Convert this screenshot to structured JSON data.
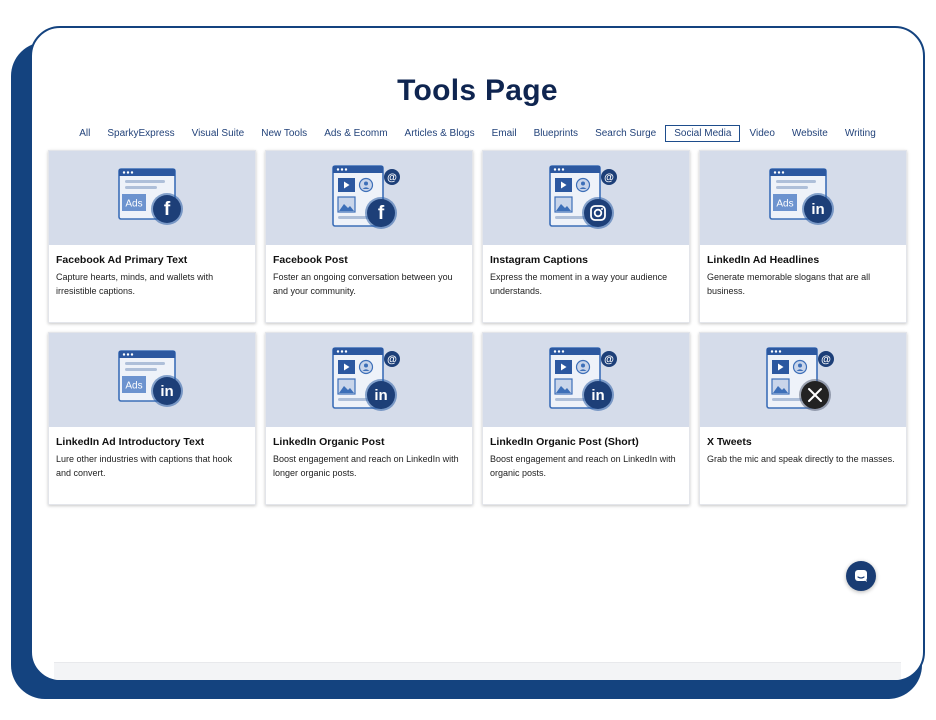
{
  "page": {
    "title": "Tools Page"
  },
  "tabs": [
    {
      "label": "All"
    },
    {
      "label": "SparkyExpress"
    },
    {
      "label": "Visual Suite"
    },
    {
      "label": "New Tools"
    },
    {
      "label": "Ads & Ecomm"
    },
    {
      "label": "Articles & Blogs"
    },
    {
      "label": "Email"
    },
    {
      "label": "Blueprints"
    },
    {
      "label": "Search Surge"
    },
    {
      "label": "Social Media",
      "active": true
    },
    {
      "label": "Video"
    },
    {
      "label": "Website"
    },
    {
      "label": "Writing"
    }
  ],
  "cards": [
    {
      "title": "Facebook Ad Primary Text",
      "desc": "Capture hearts, minds, and wallets with irresistible captions.",
      "illustration": "ads",
      "network": "facebook",
      "icon": "facebook-icon"
    },
    {
      "title": "Facebook Post",
      "desc": "Foster an ongoing conversation between you and your community.",
      "illustration": "post",
      "network": "facebook",
      "icon": "facebook-icon"
    },
    {
      "title": "Instagram Captions",
      "desc": "Express the moment in a way your audience understands.",
      "illustration": "post",
      "network": "instagram",
      "icon": "instagram-icon"
    },
    {
      "title": "LinkedIn Ad Headlines",
      "desc": "Generate memorable slogans that are all business.",
      "illustration": "ads",
      "network": "linkedin",
      "icon": "linkedin-icon"
    },
    {
      "title": "LinkedIn Ad Introductory Text",
      "desc": "Lure other industries with captions that hook and convert.",
      "illustration": "ads",
      "network": "linkedin",
      "icon": "linkedin-icon"
    },
    {
      "title": "LinkedIn Organic Post",
      "desc": "Boost engagement and reach on LinkedIn with longer organic posts.",
      "illustration": "post",
      "network": "linkedin",
      "icon": "linkedin-icon"
    },
    {
      "title": "LinkedIn Organic Post (Short)",
      "desc": "Boost engagement and reach on LinkedIn with organic posts.",
      "illustration": "post",
      "network": "linkedin",
      "icon": "linkedin-icon"
    },
    {
      "title": "X Tweets",
      "desc": "Grab the mic and speak directly to the masses.",
      "illustration": "post",
      "network": "x",
      "icon": "x-icon"
    }
  ],
  "ads_badge": "Ads",
  "at_symbol": "@",
  "chat": {
    "icon": "chat-icon"
  },
  "colors": {
    "brand_dark": "#14437f",
    "title": "#0f2550",
    "card_image_bg": "#d5dcea",
    "badge_circle": "#1d3f78",
    "x_circle": "#222222"
  }
}
